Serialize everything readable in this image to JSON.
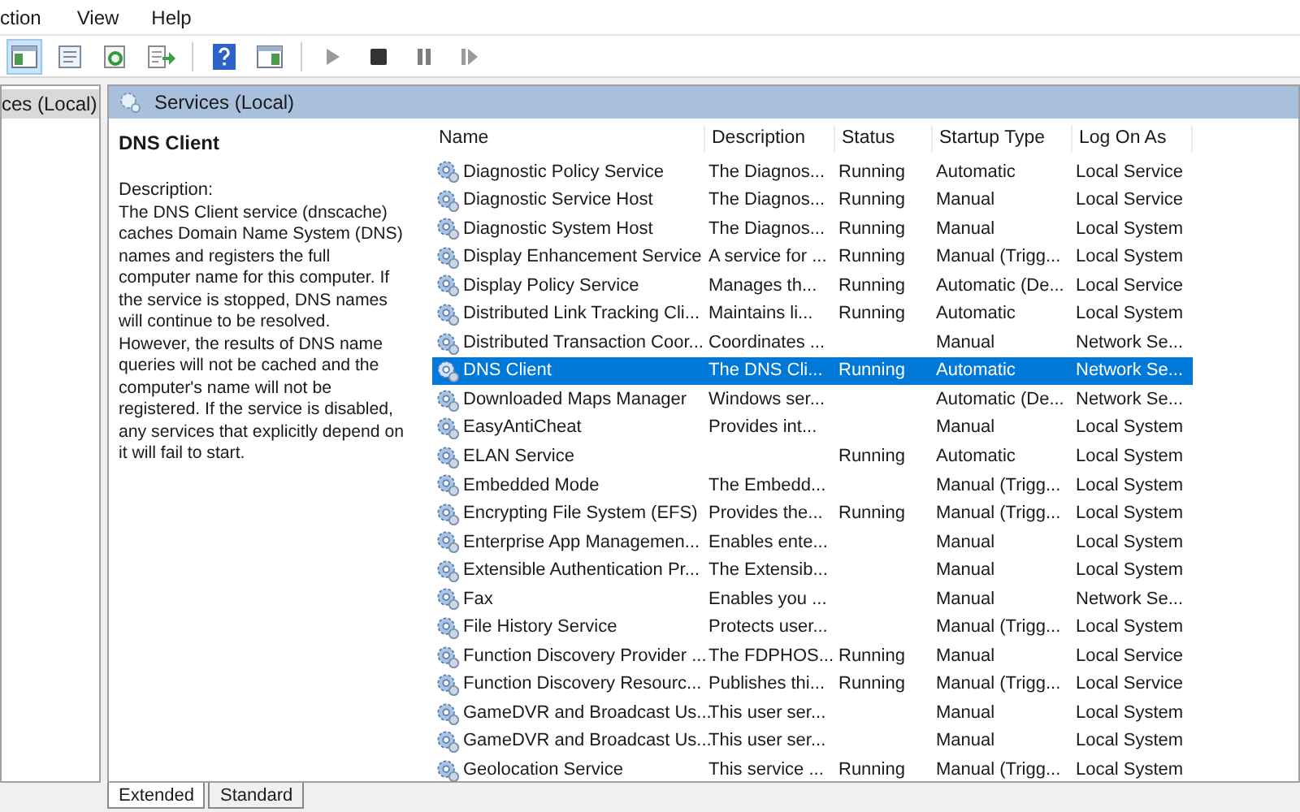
{
  "menu": [
    "ction",
    "View",
    "Help"
  ],
  "toolbar": [
    {
      "buttons": [
        {
          "kind": "tree",
          "selected": true
        },
        {
          "kind": "props",
          "selected": false
        },
        {
          "kind": "refresh",
          "selected": false
        },
        {
          "kind": "export",
          "selected": false
        }
      ]
    },
    {
      "buttons": [
        {
          "kind": "help",
          "selected": false
        },
        {
          "kind": "view",
          "selected": false
        }
      ]
    },
    {
      "buttons": [
        {
          "kind": "play",
          "selected": false
        },
        {
          "kind": "stop",
          "selected": false
        },
        {
          "kind": "pause",
          "selected": false
        },
        {
          "kind": "resume",
          "selected": false
        }
      ]
    }
  ],
  "tree": {
    "items": [
      {
        "label": "ces (Local)",
        "selected": true
      }
    ]
  },
  "pane_header": "Services (Local)",
  "details": {
    "title": "DNS Client",
    "description_label": "Description:",
    "description": "The DNS Client service (dnscache) caches Domain Name System (DNS) names and registers the full computer name for this computer. If the service is stopped, DNS names will continue to be resolved. However, the results of DNS name queries will not be cached and the computer's name will not be registered. If the service is disabled, any services that explicitly depend on it will fail to start."
  },
  "table": {
    "columns": [
      "Name",
      "Description",
      "Status",
      "Startup Type",
      "Log On As"
    ],
    "rows": [
      {
        "name": "Diagnostic Policy Service",
        "description": "The Diagnos...",
        "status": "Running",
        "startup": "Automatic",
        "logon": "Local Service",
        "selected": false
      },
      {
        "name": "Diagnostic Service Host",
        "description": "The Diagnos...",
        "status": "Running",
        "startup": "Manual",
        "logon": "Local Service",
        "selected": false
      },
      {
        "name": "Diagnostic System Host",
        "description": "The Diagnos...",
        "status": "Running",
        "startup": "Manual",
        "logon": "Local System",
        "selected": false
      },
      {
        "name": "Display Enhancement Service",
        "description": "A service for ...",
        "status": "Running",
        "startup": "Manual (Trigg...",
        "logon": "Local System",
        "selected": false
      },
      {
        "name": "Display Policy Service",
        "description": "Manages th...",
        "status": "Running",
        "startup": "Automatic (De...",
        "logon": "Local Service",
        "selected": false
      },
      {
        "name": "Distributed Link Tracking Cli...",
        "description": "Maintains li...",
        "status": "Running",
        "startup": "Automatic",
        "logon": "Local System",
        "selected": false
      },
      {
        "name": "Distributed Transaction Coor...",
        "description": "Coordinates ...",
        "startup": "Manual",
        "logon": "Network Se...",
        "selected": false
      },
      {
        "name": "DNS Client",
        "description": "The DNS Cli...",
        "status": "Running",
        "startup": "Automatic",
        "logon": "Network Se...",
        "selected": true
      },
      {
        "name": "Downloaded Maps Manager",
        "description": "Windows ser...",
        "startup": "Automatic (De...",
        "logon": "Network Se...",
        "selected": false
      },
      {
        "name": "EasyAntiCheat",
        "description": "Provides int...",
        "startup": "Manual",
        "logon": "Local System",
        "selected": false
      },
      {
        "name": "ELAN Service",
        "status": "Running",
        "startup": "Automatic",
        "logon": "Local System",
        "selected": false
      },
      {
        "name": "Embedded Mode",
        "description": "The Embedd...",
        "startup": "Manual (Trigg...",
        "logon": "Local System",
        "selected": false
      },
      {
        "name": "Encrypting File System (EFS)",
        "description": "Provides the...",
        "status": "Running",
        "startup": "Manual (Trigg...",
        "logon": "Local System",
        "selected": false
      },
      {
        "name": "Enterprise App Managemen...",
        "description": "Enables ente...",
        "startup": "Manual",
        "logon": "Local System",
        "selected": false
      },
      {
        "name": "Extensible Authentication Pr...",
        "description": "The Extensib...",
        "startup": "Manual",
        "logon": "Local System",
        "selected": false
      },
      {
        "name": "Fax",
        "description": "Enables you ...",
        "startup": "Manual",
        "logon": "Network Se...",
        "selected": false
      },
      {
        "name": "File History Service",
        "description": "Protects user...",
        "startup": "Manual (Trigg...",
        "logon": "Local System",
        "selected": false
      },
      {
        "name": "Function Discovery Provider ...",
        "description": "The FDPHOS...",
        "status": "Running",
        "startup": "Manual",
        "logon": "Local Service",
        "selected": false
      },
      {
        "name": "Function Discovery Resourc...",
        "description": "Publishes thi...",
        "status": "Running",
        "startup": "Manual (Trigg...",
        "logon": "Local Service",
        "selected": false
      },
      {
        "name": "GameDVR and Broadcast Us...",
        "description": "This user ser...",
        "startup": "Manual",
        "logon": "Local System",
        "selected": false
      },
      {
        "name": "GameDVR and Broadcast Us...",
        "description": "This user ser...",
        "startup": "Manual",
        "logon": "Local System",
        "selected": false
      },
      {
        "name": "Geolocation Service",
        "description": "This service ...",
        "status": "Running",
        "startup": "Manual (Trigg...",
        "logon": "Local System",
        "selected": false
      }
    ]
  },
  "tabs": [
    {
      "label": "Extended",
      "selected": true
    },
    {
      "label": "Standard",
      "selected": false
    }
  ]
}
